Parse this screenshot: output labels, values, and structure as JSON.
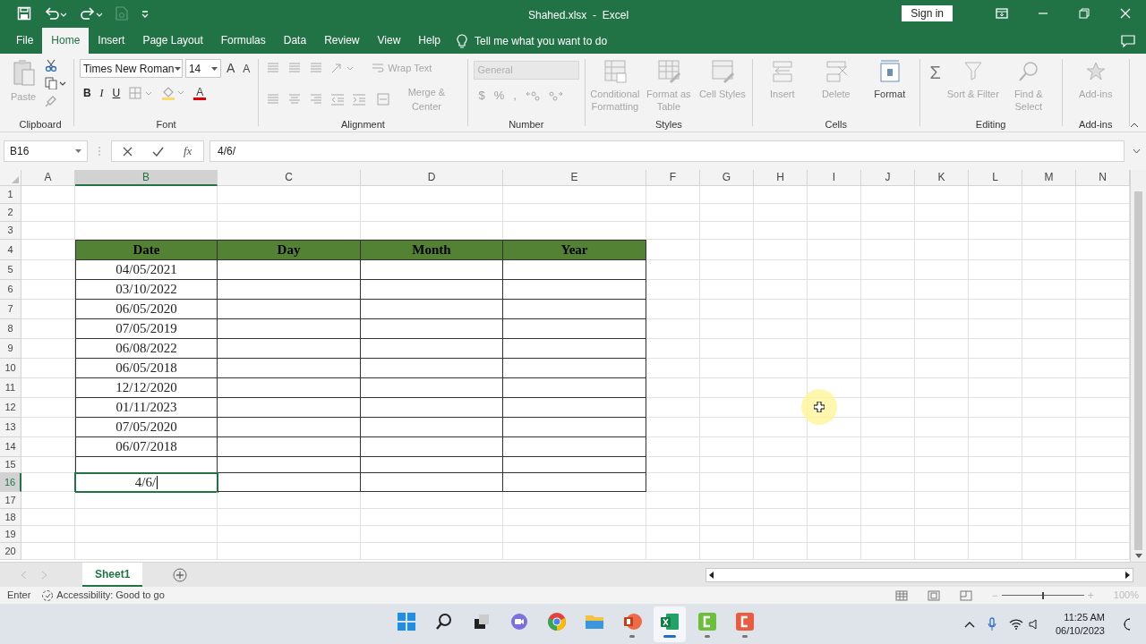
{
  "title_bar": {
    "title": "Shahed.xlsx  -  Excel",
    "sign_in": "Sign in"
  },
  "tabs": [
    {
      "label": "File",
      "selected": false
    },
    {
      "label": "Home",
      "selected": true
    },
    {
      "label": "Insert",
      "selected": false
    },
    {
      "label": "Page Layout",
      "selected": false
    },
    {
      "label": "Formulas",
      "selected": false
    },
    {
      "label": "Data",
      "selected": false
    },
    {
      "label": "Review",
      "selected": false
    },
    {
      "label": "View",
      "selected": false
    },
    {
      "label": "Help",
      "selected": false
    }
  ],
  "tell_me": "Tell me what you want to do",
  "ribbon": {
    "clipboard": {
      "label": "Clipboard",
      "paste": {
        "label": "Paste",
        "disabled": true
      }
    },
    "font": {
      "label": "Font",
      "font_name": "Times New Roman",
      "font_size": "14",
      "grow": "A",
      "shrink": "A",
      "bold": "B",
      "italic": "I",
      "underline": "U",
      "font_color": "A"
    },
    "alignment": {
      "label": "Alignment",
      "wrap_text": {
        "label": "Wrap Text",
        "disabled": true
      },
      "merge": {
        "label": "Merge & Center",
        "disabled": true
      }
    },
    "number": {
      "label": "Number",
      "format": {
        "value": "General",
        "disabled": true
      },
      "currency": "$",
      "percent": "%",
      "comma": ","
    },
    "styles": {
      "label": "Styles",
      "buttons": [
        {
          "label": "Conditional Formatting",
          "kind": "conditional",
          "disabled": true
        },
        {
          "label": "Format as Table",
          "kind": "table",
          "disabled": true
        },
        {
          "label": "Cell Styles",
          "kind": "styles",
          "disabled": true
        }
      ]
    },
    "cells": {
      "label": "Cells",
      "buttons": [
        {
          "label": "Insert",
          "kind": "insert",
          "disabled": true
        },
        {
          "label": "Delete",
          "kind": "delete",
          "disabled": true
        },
        {
          "label": "Format",
          "kind": "format",
          "disabled": false
        }
      ]
    },
    "editing": {
      "label": "Editing",
      "sum": "Σ",
      "buttons": [
        {
          "label": "Sort & Filter",
          "kind": "sort",
          "disabled": true
        },
        {
          "label": "Find & Select",
          "kind": "find",
          "disabled": true
        }
      ]
    },
    "addins": {
      "label": "Add-ins",
      "buttons": [
        {
          "label": "Add-ins",
          "kind": "addins",
          "disabled": true
        }
      ]
    }
  },
  "formula_bar": {
    "name_box": "B16",
    "fx": "fx",
    "value": "4/6/"
  },
  "sheet": {
    "columns": [
      {
        "label": "A",
        "selected": false
      },
      {
        "label": "B",
        "selected": true
      },
      {
        "label": "C",
        "selected": false
      },
      {
        "label": "D",
        "selected": false
      },
      {
        "label": "E",
        "selected": false
      },
      {
        "label": "F",
        "selected": false
      },
      {
        "label": "G",
        "selected": false
      },
      {
        "label": "H",
        "selected": false
      },
      {
        "label": "I",
        "selected": false
      },
      {
        "label": "J",
        "selected": false
      },
      {
        "label": "K",
        "selected": false
      },
      {
        "label": "L",
        "selected": false
      },
      {
        "label": "M",
        "selected": false
      },
      {
        "label": "N",
        "selected": false
      }
    ],
    "rows": [
      {
        "label": "1",
        "selected": false,
        "kind": "blank"
      },
      {
        "label": "2",
        "selected": false,
        "kind": "blank"
      },
      {
        "label": "3",
        "selected": false,
        "kind": "blank"
      },
      {
        "label": "4",
        "selected": false,
        "kind": "header",
        "cells": [
          "Date",
          "Day",
          "Month",
          "Year"
        ]
      },
      {
        "label": "5",
        "selected": false,
        "kind": "data",
        "date": "04/05/2021"
      },
      {
        "label": "6",
        "selected": false,
        "kind": "data",
        "date": "03/10/2022"
      },
      {
        "label": "7",
        "selected": false,
        "kind": "data",
        "date": "06/05/2020"
      },
      {
        "label": "8",
        "selected": false,
        "kind": "data",
        "date": "07/05/2019"
      },
      {
        "label": "9",
        "selected": false,
        "kind": "data",
        "date": "06/08/2022"
      },
      {
        "label": "10",
        "selected": false,
        "kind": "data",
        "date": "06/05/2018"
      },
      {
        "label": "11",
        "selected": false,
        "kind": "data",
        "date": "12/12/2020"
      },
      {
        "label": "12",
        "selected": false,
        "kind": "data",
        "date": "01/11/2023"
      },
      {
        "label": "13",
        "selected": false,
        "kind": "data",
        "date": "07/05/2020"
      },
      {
        "label": "14",
        "selected": false,
        "kind": "data",
        "date": "06/07/2018"
      },
      {
        "label": "15",
        "selected": false,
        "kind": "empty"
      },
      {
        "label": "16",
        "selected": true,
        "kind": "editing",
        "value": "4/6/"
      },
      {
        "label": "17",
        "selected": false,
        "kind": "blank"
      },
      {
        "label": "18",
        "selected": false,
        "kind": "blank"
      },
      {
        "label": "19",
        "selected": false,
        "kind": "blank"
      },
      {
        "label": "20",
        "selected": false,
        "kind": "blank"
      }
    ]
  },
  "sheet_tabs": [
    {
      "label": "Sheet1",
      "selected": true
    }
  ],
  "status_bar": {
    "mode": "Enter",
    "accessibility": "Accessibility: Good to go",
    "zoom": "100%",
    "zoom_out": "−",
    "zoom_in": "+",
    "zoom_slider": {
      "level": 0.5
    }
  },
  "taskbar": {
    "apps": [
      {
        "kind": "start",
        "running": false,
        "active": false
      },
      {
        "kind": "search",
        "running": false,
        "active": false
      },
      {
        "kind": "taskview",
        "running": false,
        "active": false
      },
      {
        "kind": "chat",
        "running": false,
        "active": false
      },
      {
        "kind": "browser",
        "running": false,
        "active": false
      },
      {
        "kind": "folder",
        "running": false,
        "active": false
      },
      {
        "kind": "slides",
        "running": true,
        "active": false
      },
      {
        "kind": "sheets",
        "running": true,
        "active": true
      },
      {
        "kind": "recorder",
        "running": true,
        "active": false
      },
      {
        "kind": "editor",
        "running": true,
        "active": false
      }
    ],
    "time": "11:25 AM",
    "date": "06/10/2023"
  }
}
